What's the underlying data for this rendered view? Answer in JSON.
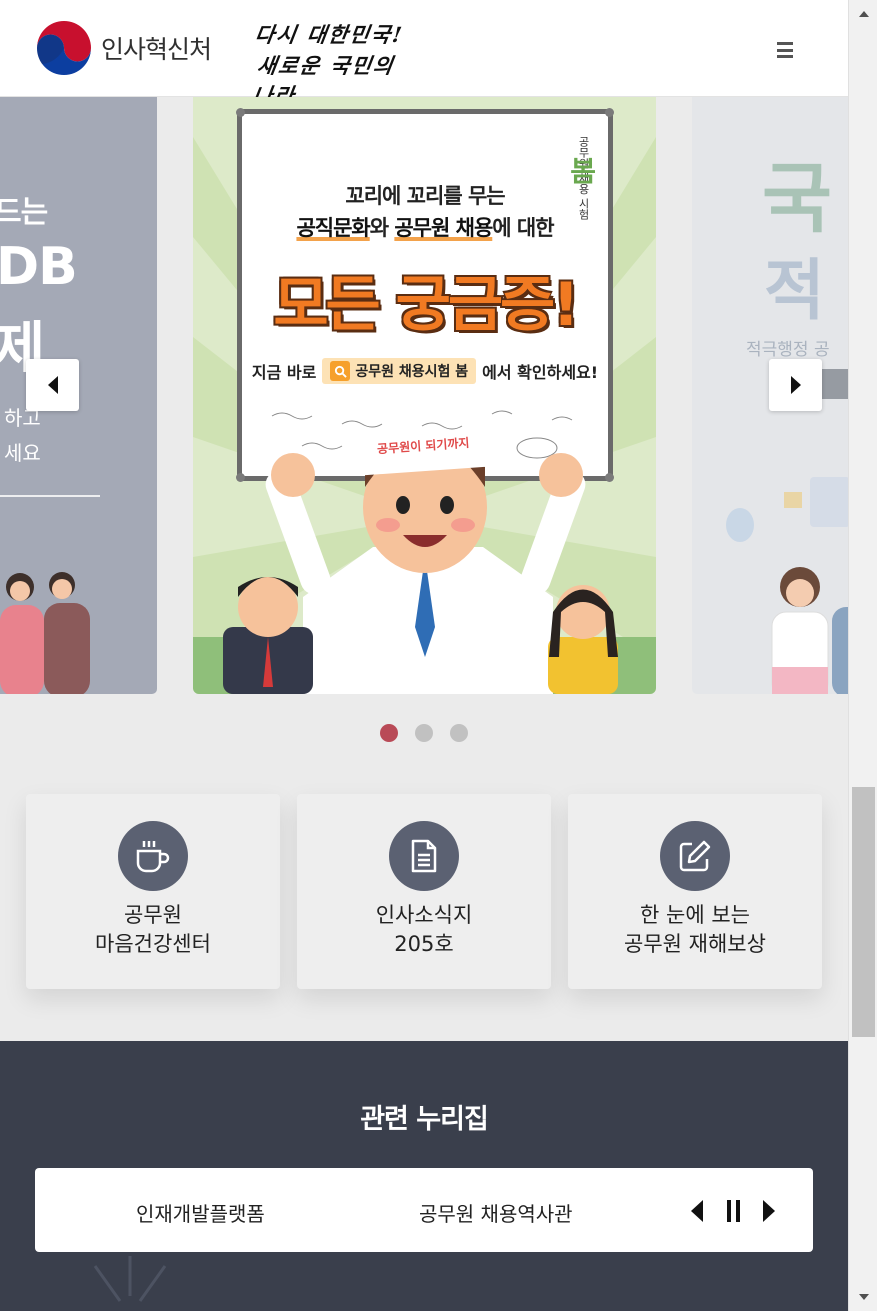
{
  "header": {
    "org_name": "인사혁신처",
    "slogan_line1": "다시 대한민국!",
    "slogan_line2": "새로운 국민의 나라",
    "menu_icon": "hamburger-menu-icon"
  },
  "carousel": {
    "left_slide": {
      "line1": "드는",
      "line2": "DB",
      "line3": "제",
      "line4": "하고",
      "line5": "세요"
    },
    "center_slide": {
      "line1": "꼬리에 꼬리를 무는",
      "line2_em1": "공직문화",
      "line2_mid": "와 ",
      "line2_em2": "공무원 채용",
      "line2_end": "에 대한",
      "headline": "모든 궁금증!",
      "line3_pre": "지금 바로",
      "search_label": "공무원 채용시험 봄",
      "line3_post": "에서 확인하세요!",
      "corner_label": "공무원 채용 시험",
      "corner_mark": "봄",
      "headband": "공무원이 되기까지"
    },
    "right_slide": {
      "line1": "국",
      "line2": "적",
      "line3": "적극행정 공"
    },
    "prev_icon": "caret-left-icon",
    "next_icon": "caret-right-icon",
    "dots": 3,
    "active_dot": 1
  },
  "quick_links": [
    {
      "icon": "coffee-cup-icon",
      "line1": "공무원",
      "line2": "마음건강센터"
    },
    {
      "icon": "document-icon",
      "line1": "인사소식지",
      "line2": "205호"
    },
    {
      "icon": "edit-icon",
      "line1": "한 눈에 보는",
      "line2": "공무원 재해보상"
    }
  ],
  "related": {
    "title": "관련 누리집",
    "items": [
      "인재개발플랫폼",
      "공무원 채용역사관"
    ],
    "prev_icon": "caret-left-icon",
    "pause_icon": "pause-icon",
    "next_icon": "caret-right-icon"
  },
  "colors": {
    "active_dot": "#b94a57",
    "icon_circle": "#5b6172",
    "footer_bg": "#3a3f4c",
    "headline_orange": "#f17a22"
  }
}
